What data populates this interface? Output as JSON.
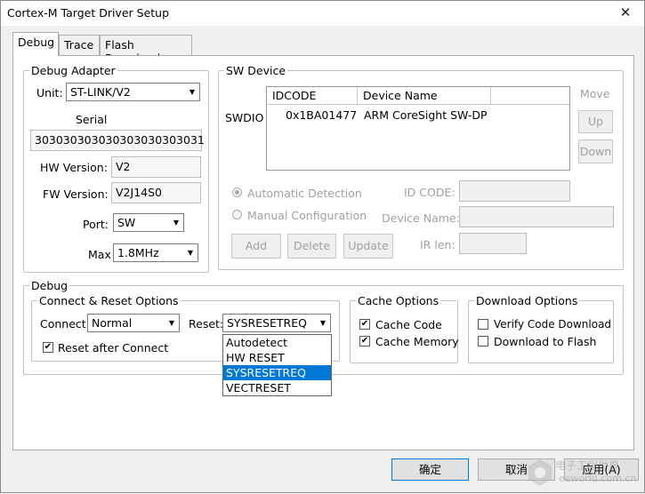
{
  "window": {
    "title": "Cortex-M Target Driver Setup",
    "close_glyph": "✕"
  },
  "tabs": [
    {
      "label": "Debug"
    },
    {
      "label": "Trace"
    },
    {
      "label": "Flash Download"
    }
  ],
  "debug_adapter": {
    "legend": "Debug Adapter",
    "unit_label": "Unit:",
    "unit_value": "ST-LINK/V2",
    "serial_label": "Serial",
    "serial_value": "303030303030303030303031",
    "hw_label": "HW Version:",
    "hw_value": "V2",
    "fw_label": "FW Version:",
    "fw_value": "V2J14S0",
    "port_label": "Port:",
    "port_value": "SW",
    "max_label": "Max",
    "max_value": "1.8MHz"
  },
  "sw_device": {
    "legend": "SW Device",
    "swdio_label": "SWDIO",
    "columns": [
      "IDCODE",
      "Device Name"
    ],
    "rows": [
      {
        "idcode": "0x1BA01477",
        "name": "ARM CoreSight SW-DP"
      }
    ],
    "move_label": "Move",
    "up_label": "Up",
    "down_label": "Down",
    "auto_detection": "Automatic Detection",
    "manual_config": "Manual Configuration",
    "id_code_label": "ID CODE:",
    "device_name_label": "Device Name:",
    "ir_len_label": "IR len:",
    "add_label": "Add",
    "delete_label": "Delete",
    "update_label": "Update"
  },
  "debug": {
    "legend": "Debug",
    "connect_reset_legend": "Connect & Reset Options",
    "connect_label": "Connect:",
    "connect_value": "Normal",
    "reset_label": "Reset:",
    "reset_value": "SYSRESETREQ",
    "reset_after_connect": "Reset after Connect",
    "reset_options": [
      "Autodetect",
      "HW RESET",
      "SYSRESETREQ",
      "VECTRESET"
    ],
    "cache_legend": "Cache Options",
    "cache_code": "Cache Code",
    "cache_memory": "Cache Memory",
    "download_legend": "Download Options",
    "verify_code": "Verify Code Download",
    "download_to_flash": "Download to Flash"
  },
  "footer": {
    "ok_label": "确定",
    "cancel_label": "取消",
    "apply_label": "应用(A)",
    "watermark_cn": "电子工程世界",
    "watermark_url": "eeworld.com.cn"
  },
  "colors": {
    "selection": "#0078d7",
    "window_bg": "#f0f0f0"
  }
}
